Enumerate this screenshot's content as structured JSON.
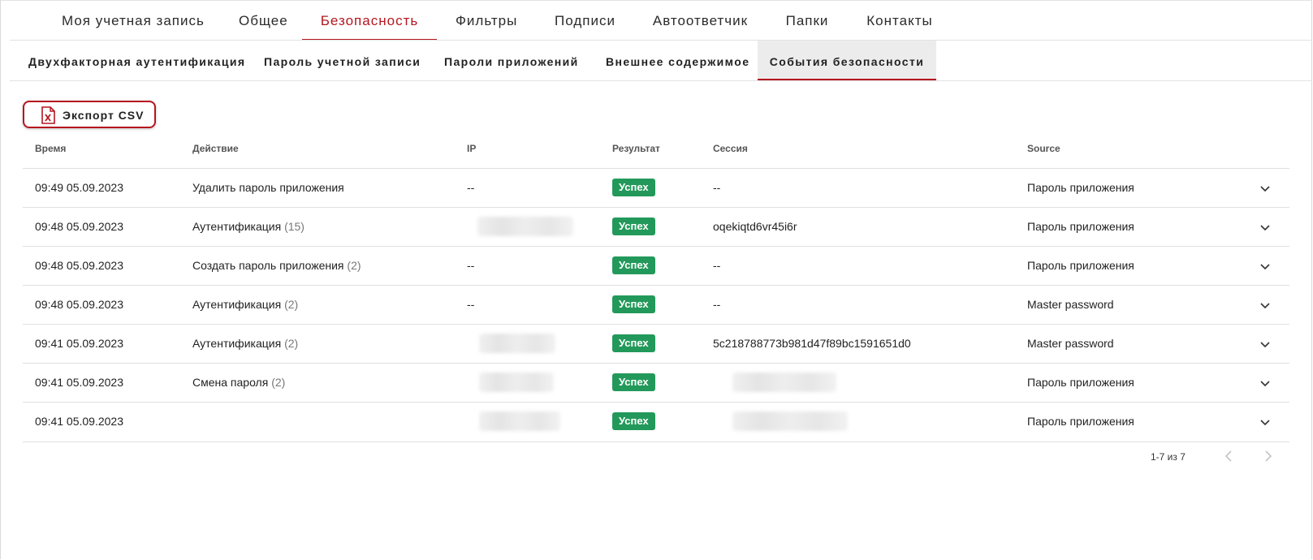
{
  "main_tabs": [
    {
      "label": "Моя учетная запись",
      "active": false
    },
    {
      "label": "Общее",
      "active": false
    },
    {
      "label": "Безопасность",
      "active": true
    },
    {
      "label": "Фильтры",
      "active": false
    },
    {
      "label": "Подписи",
      "active": false
    },
    {
      "label": "Автоответчик",
      "active": false
    },
    {
      "label": "Папки",
      "active": false
    },
    {
      "label": "Контакты",
      "active": false
    }
  ],
  "sub_tabs": [
    {
      "label": "Двухфакторная аутентификация",
      "active": false
    },
    {
      "label": "Пароль учетной записи",
      "active": false
    },
    {
      "label": "Пароли приложений",
      "active": false
    },
    {
      "label": "Внешнее содержимое",
      "active": false
    },
    {
      "label": "События безопасности",
      "active": true
    }
  ],
  "export_button": {
    "label": "Экспорт CSV",
    "icon": "file-excel-icon"
  },
  "table": {
    "headers": {
      "time": "Время",
      "action": "Действие",
      "ip": "IP",
      "result": "Результат",
      "session": "Сессия",
      "source": "Source"
    },
    "rows": [
      {
        "time": "09:49 05.09.2023",
        "action": "Удалить пароль приложения",
        "count": "",
        "ip": "--",
        "ip_hidden": false,
        "result": "Успех",
        "session": "--",
        "session_hidden": false,
        "source": "Пароль приложения"
      },
      {
        "time": "09:48 05.09.2023",
        "action": "Аутентификация",
        "count": "(15)",
        "ip": "",
        "ip_hidden": true,
        "result": "Успех",
        "session": "oqekiqtd6vr45i6r",
        "session_hidden": false,
        "source": "Пароль приложения"
      },
      {
        "time": "09:48 05.09.2023",
        "action": "Создать пароль приложения",
        "count": "(2)",
        "ip": "--",
        "ip_hidden": false,
        "result": "Успех",
        "session": "--",
        "session_hidden": false,
        "source": "Пароль приложения"
      },
      {
        "time": "09:48 05.09.2023",
        "action": "Аутентификация",
        "count": "(2)",
        "ip": "--",
        "ip_hidden": false,
        "result": "Успех",
        "session": "--",
        "session_hidden": false,
        "source": "Master password"
      },
      {
        "time": "09:41 05.09.2023",
        "action": "Аутентификация",
        "count": "(2)",
        "ip": "",
        "ip_hidden": true,
        "result": "Успех",
        "session": "5c218788773b981d47f89bc1591651d0",
        "session_hidden": false,
        "source": "Master password"
      },
      {
        "time": "09:41 05.09.2023",
        "action": "Смена пароля",
        "count": "(2)",
        "ip": "",
        "ip_hidden": true,
        "result": "Успех",
        "session": "",
        "session_hidden": true,
        "source": "Пароль приложения"
      },
      {
        "time": "09:41 05.09.2023",
        "action": "",
        "count": "",
        "ip": "",
        "ip_hidden": true,
        "result": "Успех",
        "session": "",
        "session_hidden": true,
        "source": "Пароль приложения"
      }
    ]
  },
  "pagination": {
    "text": "1-7 из 7",
    "prev_icon": "chevron-left-icon",
    "next_icon": "chevron-right-icon"
  },
  "colors": {
    "accent": "#b5161f",
    "success": "#22995a"
  }
}
